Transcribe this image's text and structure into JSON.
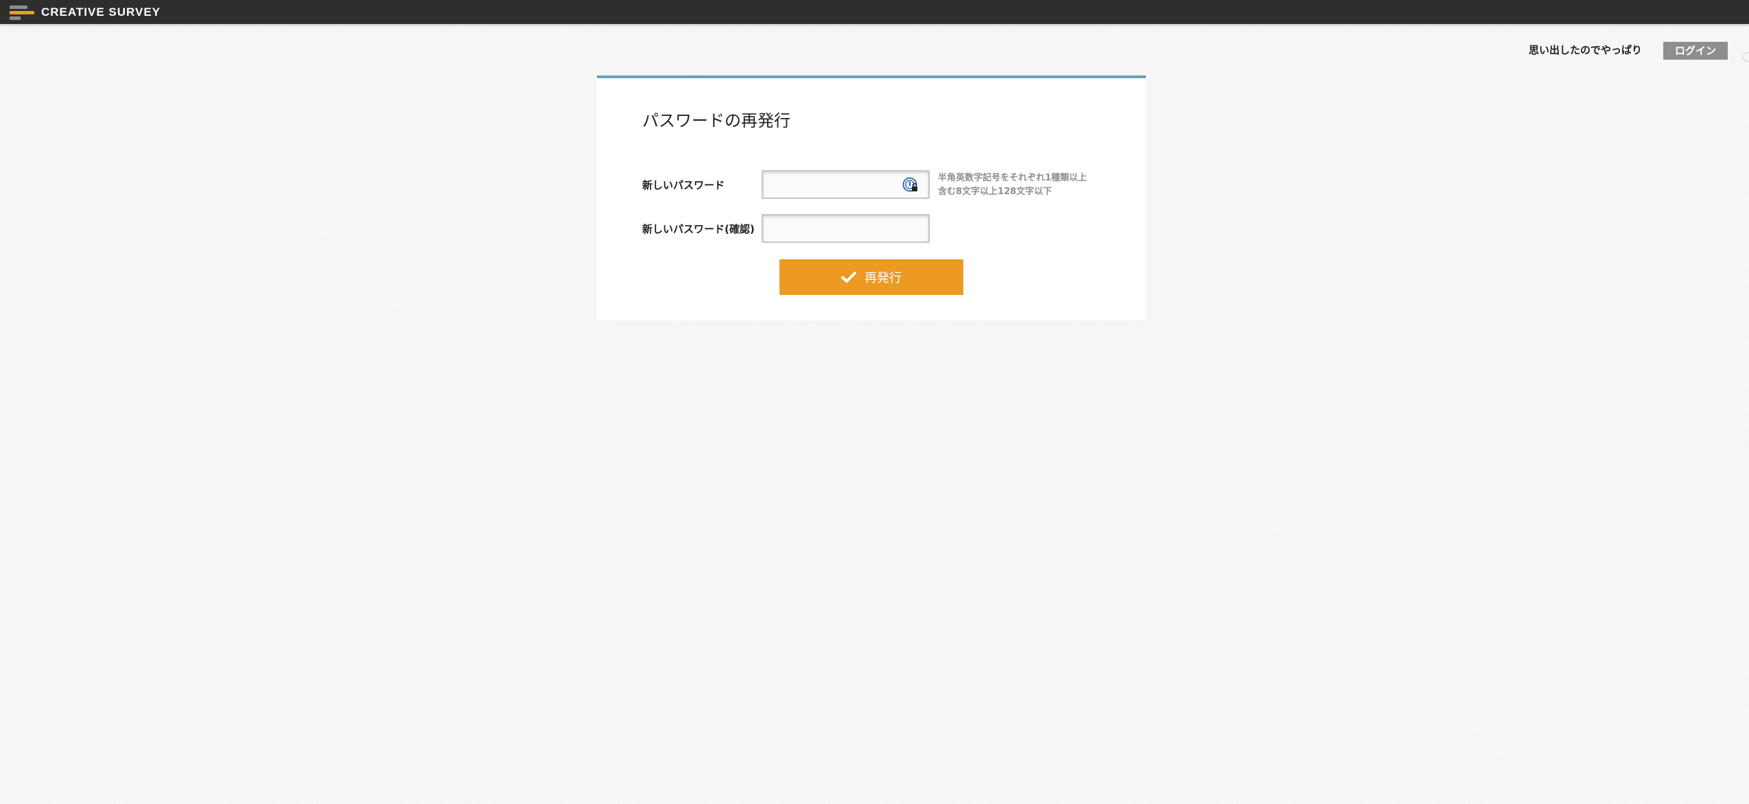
{
  "header": {
    "brand": "CREATIVE SURVEY",
    "forgot_link": "思い出したのでやっぱり",
    "login_label": "ログイン"
  },
  "form": {
    "title": "パスワードの再発行",
    "new_password_label": "新しいパスワード",
    "new_password_value": "",
    "confirm_password_label": "新しいパスワード(確認)",
    "confirm_password_value": "",
    "hint_line1": "半角英数字記号をそれぞれ1種類以上",
    "hint_line2": "含む8文字以上128文字以下",
    "submit_label": "再発行"
  },
  "icons": {
    "logo": "creative-survey-logo",
    "password_manager": "password-manager-icon",
    "submit": "check-icon"
  },
  "colors": {
    "topbar": "#2e2e2e",
    "accent_orange": "#ec9a21",
    "card_border": "#6c9fb3",
    "login_button": "#8e8e8e",
    "hint_text": "#8f8f8f"
  }
}
